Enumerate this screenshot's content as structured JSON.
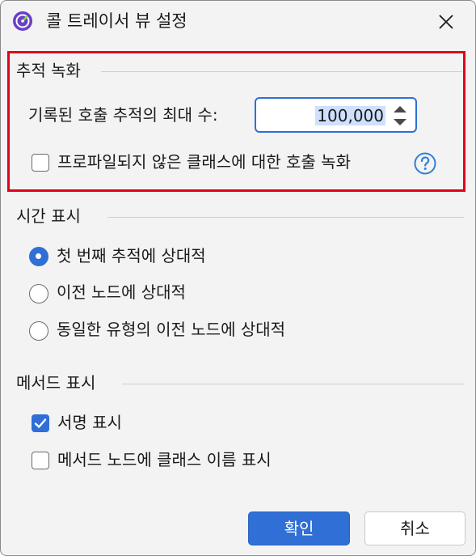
{
  "window": {
    "title": "콜 트레이서 뷰 설정"
  },
  "colors": {
    "accent": "#2f6fd6",
    "highlight_border": "#e2001a",
    "window_bg": "#f3f3f3"
  },
  "tracking_group": {
    "title": "추적 녹화",
    "max_traces_label": "기록된 호출 추적의 최대 수:",
    "max_traces_value": "100,000",
    "record_unprofiled_label": "프로파일되지 않은 클래스에 대한 호출 녹화",
    "record_unprofiled_checked": false,
    "help_icon": "question-circle-icon"
  },
  "time_group": {
    "title": "시간 표시",
    "options": [
      {
        "label": "첫 번째 추적에 상대적",
        "selected": true
      },
      {
        "label": "이전 노드에 상대적",
        "selected": false
      },
      {
        "label": "동일한 유형의 이전 노드에 상대적",
        "selected": false
      }
    ]
  },
  "method_group": {
    "title": "메서드 표시",
    "options": [
      {
        "label": "서명 표시",
        "checked": true
      },
      {
        "label": "메서드 노드에 클래스 이름 표시",
        "checked": false
      }
    ]
  },
  "buttons": {
    "ok_label": "확인",
    "cancel_label": "취소"
  }
}
